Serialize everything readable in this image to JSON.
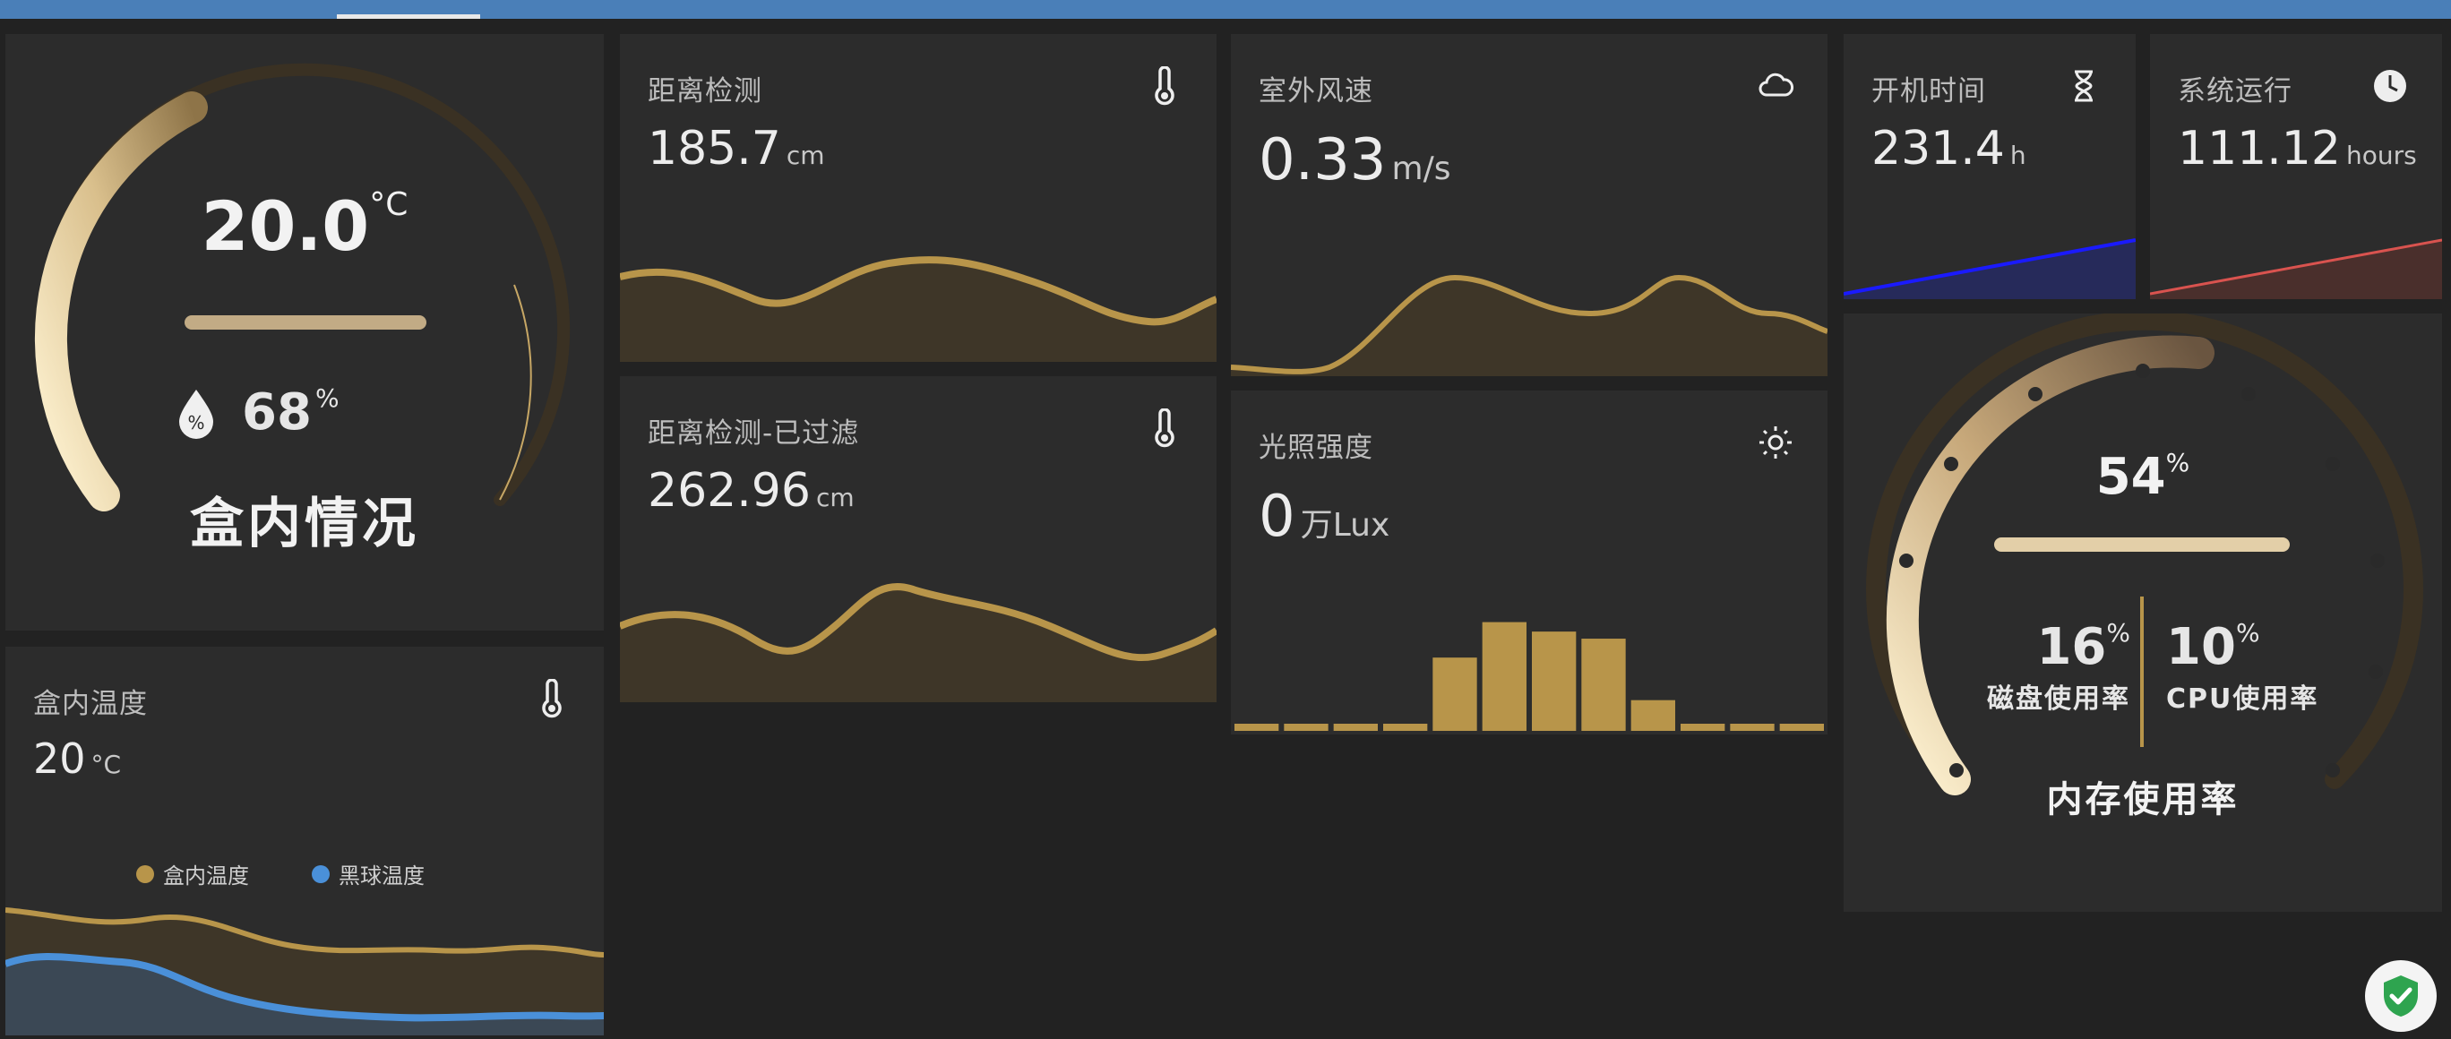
{
  "theme": {
    "accent_gold": "#b8954a",
    "fill_gold": "#3e3628",
    "accent_blue": "#4a90d9",
    "uptime_line": "#1a1aff",
    "runtime_line": "#d9534f"
  },
  "box_gauge": {
    "temperature": "20.0",
    "temperature_unit": "°C",
    "humidity": "68",
    "humidity_unit": "%",
    "title": "盒内情况"
  },
  "distance": {
    "title": "距离检测",
    "value": "185.7",
    "unit": "cm",
    "icon": "thermometer-icon"
  },
  "distance_filtered": {
    "title": "距离检测-已过滤",
    "value": "262.96",
    "unit": "cm",
    "icon": "thermometer-icon"
  },
  "wind": {
    "title": "室外风速",
    "value": "0.33",
    "unit": "m/s",
    "icon": "cloud-icon"
  },
  "light": {
    "title": "光照强度",
    "value": "0",
    "unit": "万Lux",
    "icon": "brightness-icon"
  },
  "uptime": {
    "title": "开机时间",
    "value": "231.4",
    "unit": "h",
    "icon": "hourglass-icon"
  },
  "runtime": {
    "title": "系统运行",
    "value": "111.12",
    "unit": "hours",
    "icon": "clock-icon"
  },
  "box_temp": {
    "title": "盒内温度",
    "value": "20",
    "unit": "°C",
    "icon": "thermometer-icon",
    "legend": [
      {
        "name": "盒内温度",
        "color": "#b8954a"
      },
      {
        "name": "黑球温度",
        "color": "#4a90d9"
      }
    ]
  },
  "system_gauge": {
    "memory": "54",
    "memory_unit": "%",
    "disk": "16",
    "disk_unit": "%",
    "disk_label": "磁盘使用率",
    "cpu": "10",
    "cpu_unit": "%",
    "cpu_label": "CPU使用率",
    "title": "内存使用率",
    "memory_level": 0.54
  },
  "light_hist": [
    0.05,
    0.05,
    0.05,
    0.05,
    0.62,
    0.92,
    0.84,
    0.78,
    0.26,
    0.05,
    0.05,
    0.05
  ]
}
